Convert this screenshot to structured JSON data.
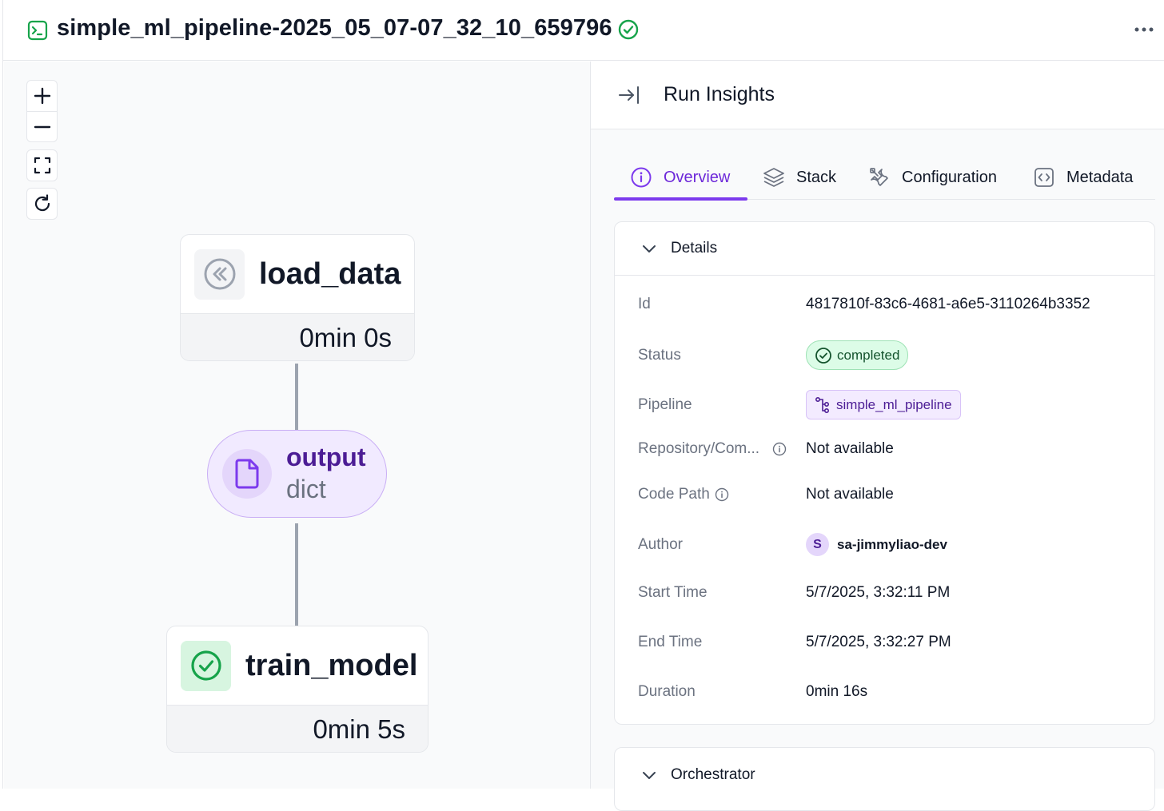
{
  "header": {
    "title": "simple_ml_pipeline-2025_05_07-07_32_10_659796",
    "status": "completed",
    "icons": {
      "run": "terminal-icon",
      "status": "check-circle-icon",
      "more": "more-horizontal-icon"
    }
  },
  "canvas_controls": [
    {
      "name": "zoom-in",
      "icon": "plus-icon"
    },
    {
      "name": "zoom-out",
      "icon": "minus-icon"
    },
    {
      "name": "fit-view",
      "icon": "fullscreen-icon"
    },
    {
      "name": "refresh",
      "icon": "refresh-icon"
    }
  ],
  "dag": {
    "steps": [
      {
        "name": "load_data",
        "duration": "0min 0s",
        "icon": "rewind-icon"
      },
      {
        "name": "train_model",
        "duration": "0min 5s",
        "icon": "check-circle-icon"
      }
    ],
    "artifact": {
      "name": "output",
      "type": "dict",
      "icon": "file-icon"
    }
  },
  "panel": {
    "title": "Run Insights",
    "tabs": [
      {
        "label": "Overview",
        "icon": "info-icon",
        "active": true
      },
      {
        "label": "Stack",
        "icon": "layers-icon",
        "active": false
      },
      {
        "label": "Configuration",
        "icon": "tools-icon",
        "active": false
      },
      {
        "label": "Metadata",
        "icon": "code-brackets-icon",
        "active": false
      }
    ],
    "details": {
      "title": "Details",
      "id_label": "Id",
      "id_value": "4817810f-83c6-4681-a6e5-3110264b3352",
      "status_label": "Status",
      "status_value": "completed",
      "pipeline_label": "Pipeline",
      "pipeline_value": "simple_ml_pipeline",
      "repo_label": "Repository/Com...",
      "repo_value": "Not available",
      "codepath_label": "Code Path",
      "codepath_value": "Not available",
      "author_label": "Author",
      "author_initial": "S",
      "author_value": "sa-jimmyliao-dev",
      "start_label": "Start Time",
      "start_value": "5/7/2025, 3:32:11 PM",
      "end_label": "End Time",
      "end_value": "5/7/2025, 3:32:27 PM",
      "duration_label": "Duration",
      "duration_value": "0min 16s"
    },
    "orchestrator": {
      "title": "Orchestrator"
    }
  },
  "colors": {
    "accent": "#7c3aed",
    "success": "#16a34a",
    "edge": "#9ca3af"
  }
}
